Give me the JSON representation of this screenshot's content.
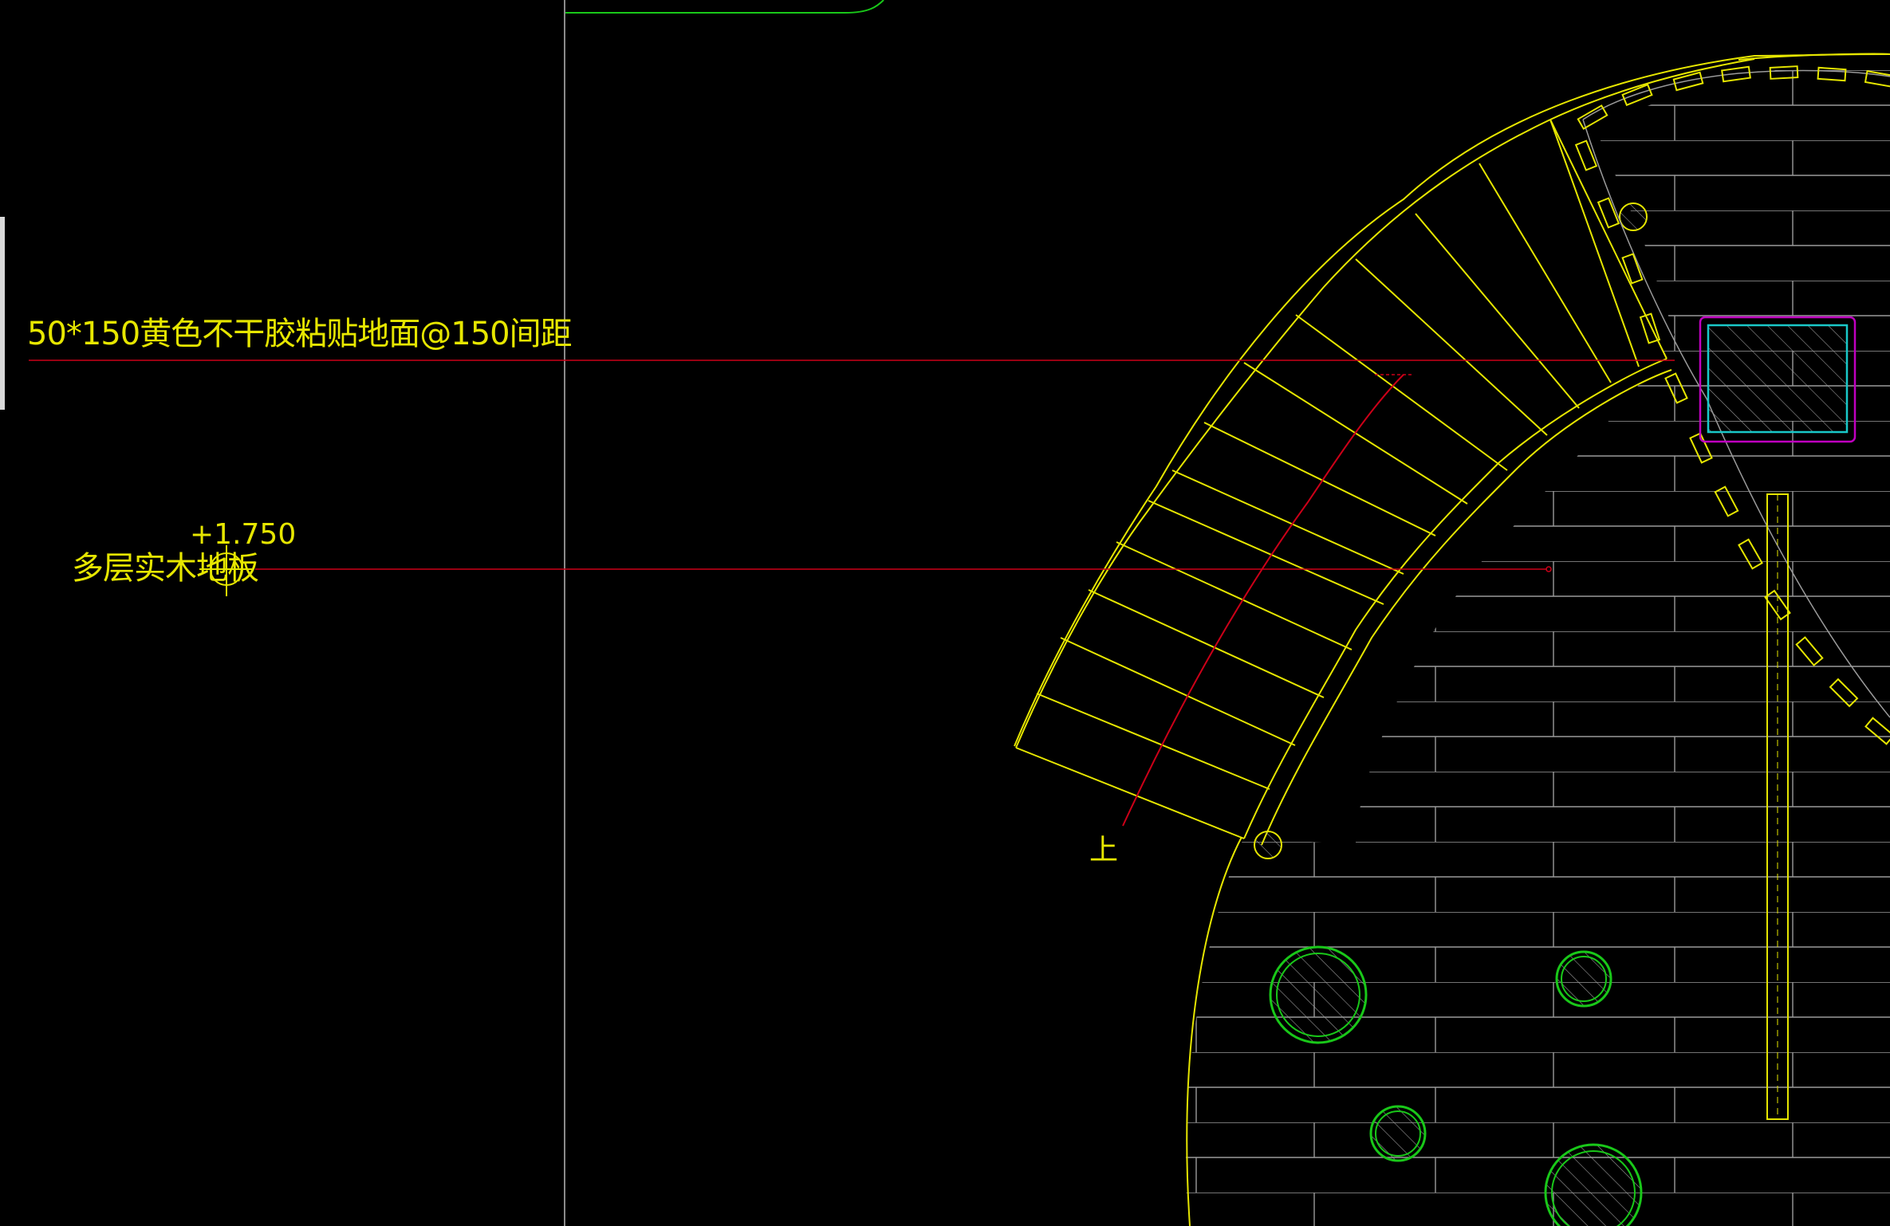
{
  "drawing": {
    "colors": {
      "background": "#000000",
      "floor": "#e6e600",
      "leader": "#cc0018",
      "vertical_line": "#8a8a8a",
      "tree": "#19c819",
      "column_outline": "#c000c0",
      "column_fill": "#19c8c8",
      "left_bar": "#d9d9d9"
    },
    "annotations": {
      "floor_spec": "50*150黄色不干胶粘贴地面@150间距",
      "elevation": "+1.750",
      "material": "多层实木地板",
      "stair_direction": "上"
    },
    "icons": {
      "elevation_marker": "crosshair-circle-icon",
      "tree_symbol": "circle-hatched-icon"
    }
  }
}
